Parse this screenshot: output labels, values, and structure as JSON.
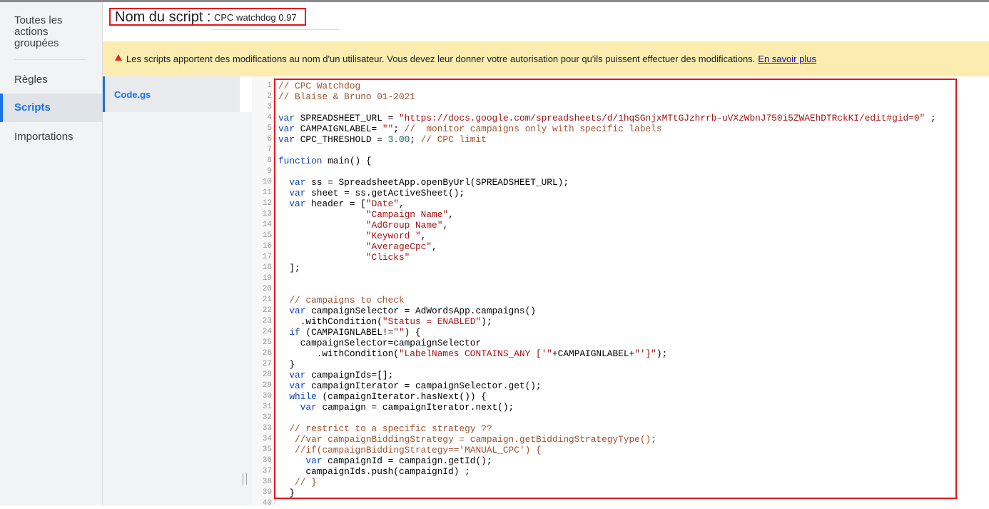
{
  "nav": {
    "items": [
      {
        "label": "Toutes les actions groupées",
        "lines": [
          "Toutes les",
          "actions",
          "groupées"
        ]
      },
      {
        "label": "Règles"
      },
      {
        "label": "Scripts"
      },
      {
        "label": "Importations"
      }
    ]
  },
  "script": {
    "name_label": "Nom du script :",
    "name_value": "CPC watchdog 0.97"
  },
  "banner": {
    "text": "Les scripts apportent des modifications au nom d'un utilisateur. Vous devez leur donner votre autorisation pour qu'ils puissent effectuer des modifications.",
    "link": "En savoir plus"
  },
  "files": {
    "tabs": [
      "Code.gs"
    ]
  },
  "editor": {
    "lines": [
      "// CPC Watchdog",
      "// Blaise & Bruno 01-2021",
      "",
      "var SPREADSHEET_URL = \"https://docs.google.com/spreadsheets/d/1hqSGnjxMTtGJzhrrb-uVXzWbnJ750i5ZWAEhDTRckKI/edit#gid=0\" ;",
      "var CAMPAIGNLABEL= \"\"; //  monitor campaigns only with specific labels",
      "var CPC_THRESHOLD = 3.00; // CPC limit",
      "",
      "function main() {",
      "",
      "  var ss = SpreadsheetApp.openByUrl(SPREADSHEET_URL);",
      "  var sheet = ss.getActiveSheet();",
      "  var header = [\"Date\",",
      "                \"Campaign Name\",",
      "                \"AdGroup Name\",",
      "                \"Keyword \",",
      "                \"AverageCpc\",",
      "                \"Clicks\"",
      "  ];",
      "",
      "",
      "  // campaigns to check",
      "  var campaignSelector = AdWordsApp.campaigns()",
      "    .withCondition(\"Status = ENABLED\");",
      "  if (CAMPAIGNLABEL!=\"\") {",
      "    campaignSelector=campaignSelector",
      "       .withCondition(\"LabelNames CONTAINS_ANY ['\"+CAMPAIGNLABEL+\"']\");",
      "  }",
      "  var campaignIds=[];",
      "  var campaignIterator = campaignSelector.get();",
      "  while (campaignIterator.hasNext()) {",
      "    var campaign = campaignIterator.next();",
      "",
      "  // restrict to a specific strategy ??",
      "   //var campaignBiddingStrategy = campaign.getBiddingStrategyType();",
      "   //if(campaignBiddingStrategy=='MANUAL_CPC') {",
      "     var campaignId = campaign.getId();",
      "     campaignIds.push(campaignId) ;",
      "   // }",
      "  }",
      ""
    ]
  },
  "colors": {
    "accent": "#1a73e8",
    "highlight_border": "#e8151b",
    "banner_bg": "#fcecb0",
    "warning": "#d93025"
  },
  "icons": {
    "banner": "warning-triangle-icon"
  }
}
